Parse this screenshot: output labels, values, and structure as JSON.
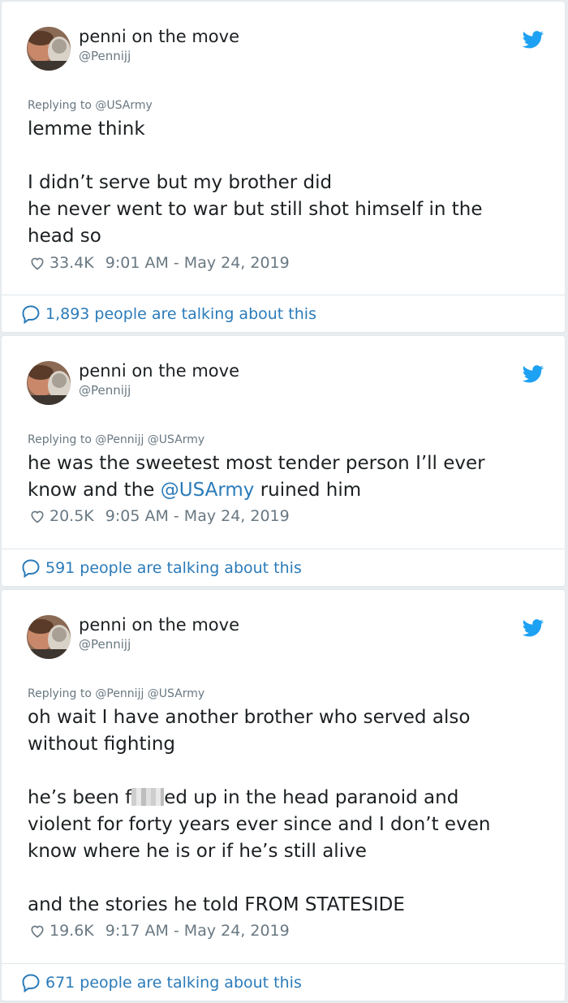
{
  "tweets": [
    {
      "author_name": "penni on the move",
      "author_handle": "@Pennijj",
      "replying_to": "Replying to @USArmy",
      "text": {
        "p1": "lemme think",
        "p2_l1": "I didn’t serve but my brother did",
        "p2_l2": "he never went to war but still shot himself in the",
        "p2_l3": "head so"
      },
      "likes": "33.4K",
      "timestamp": "9:01 AM - May 24, 2019",
      "talking": "1,893 people are talking about this"
    },
    {
      "author_name": "penni on the move",
      "author_handle": "@Pennijj",
      "replying_to": "Replying to @Pennijj @USArmy",
      "text": {
        "l1": "he was the sweetest most tender person I’ll ever",
        "l2_before": "know and the ",
        "l2_mention": "@USArmy",
        "l2_after": " ruined him"
      },
      "likes": "20.5K",
      "timestamp": "9:05 AM - May 24, 2019",
      "talking": "591 people are talking about this"
    },
    {
      "author_name": "penni on the move",
      "author_handle": "@Pennijj",
      "replying_to": "Replying to @Pennijj @USArmy",
      "text": {
        "p1_l1": "oh wait I have another brother who served also",
        "p1_l2": "without fighting",
        "p2_l1_before": "he’s been f",
        "p2_l1_after": "ed up in the head paranoid and",
        "p2_l2": "violent for forty years ever since and I don’t even",
        "p2_l3": "know where he is or if he’s still alive",
        "p3": "and the stories he told FROM STATESIDE"
      },
      "likes": "19.6K",
      "timestamp": "9:17 AM - May 24, 2019",
      "talking": "671 people are talking about this"
    }
  ],
  "icons": {
    "like": "heart-outline-icon",
    "talk": "speech-bubble-icon",
    "brand": "twitter-bird-icon"
  },
  "colors": {
    "link": "#2b7bb9",
    "muted": "#697882",
    "text": "#1c2022",
    "twitter_blue": "#1da1f2"
  }
}
